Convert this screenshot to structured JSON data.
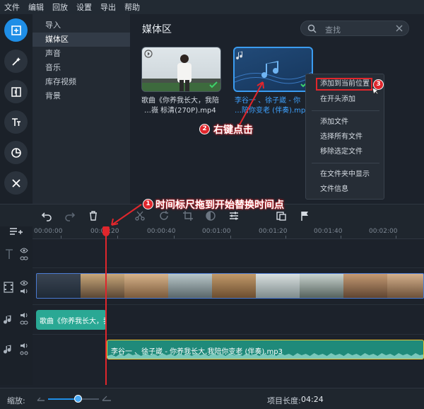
{
  "menu": [
    "文件",
    "编辑",
    "回放",
    "设置",
    "导出",
    "帮助"
  ],
  "categories": [
    {
      "label": "导入",
      "selected": false
    },
    {
      "label": "媒体区",
      "selected": true
    },
    {
      "label": "声音",
      "selected": false
    },
    {
      "label": "音乐",
      "selected": false
    },
    {
      "label": "库存视频",
      "selected": false
    },
    {
      "label": "背景",
      "selected": false
    }
  ],
  "media": {
    "title": "媒体区",
    "search_placeholder": "查找",
    "items": [
      {
        "line1": "歌曲《你养我长大，我陪",
        "line2": "…嶶 标清(270P).mp4"
      },
      {
        "line1": "李谷一 、徐子崴 - 你",
        "line2": "…陪你变老 (伴奏).mp"
      }
    ]
  },
  "context_menu": {
    "items": [
      "添加到当前位置",
      "在开头添加",
      "添加文件",
      "选择所有文件",
      "移除选定文件",
      "在文件夹中显示",
      "文件信息"
    ]
  },
  "annotations": {
    "step1": "时间标尺拖到开始替换时间点",
    "step2": "右键点击",
    "n1": "1",
    "n2": "2",
    "n3": "3"
  },
  "ruler": {
    "labels": [
      "00:00:00",
      "00:00:20",
      "00:00:40",
      "00:01:00",
      "00:01:20",
      "00:01:40",
      "00:02:00"
    ],
    "playhead_label": "00:00:20"
  },
  "timeline": {
    "audio1_label": "歌曲《你养我长大，我",
    "audio2_label": "李谷一 、徐子崴 - 你养我长大,我陪你变老 (伴奏).mp3"
  },
  "status": {
    "zoom_label": "缩放:",
    "zoom_level": 0.6,
    "project_length_label": "项目长度:",
    "project_length": "04:24"
  },
  "colors": {
    "accent": "#1f8ee6",
    "annotation_red": "#e0262c",
    "audio_clip": "#2aa894",
    "selected_clip_border": "#e8c430"
  }
}
